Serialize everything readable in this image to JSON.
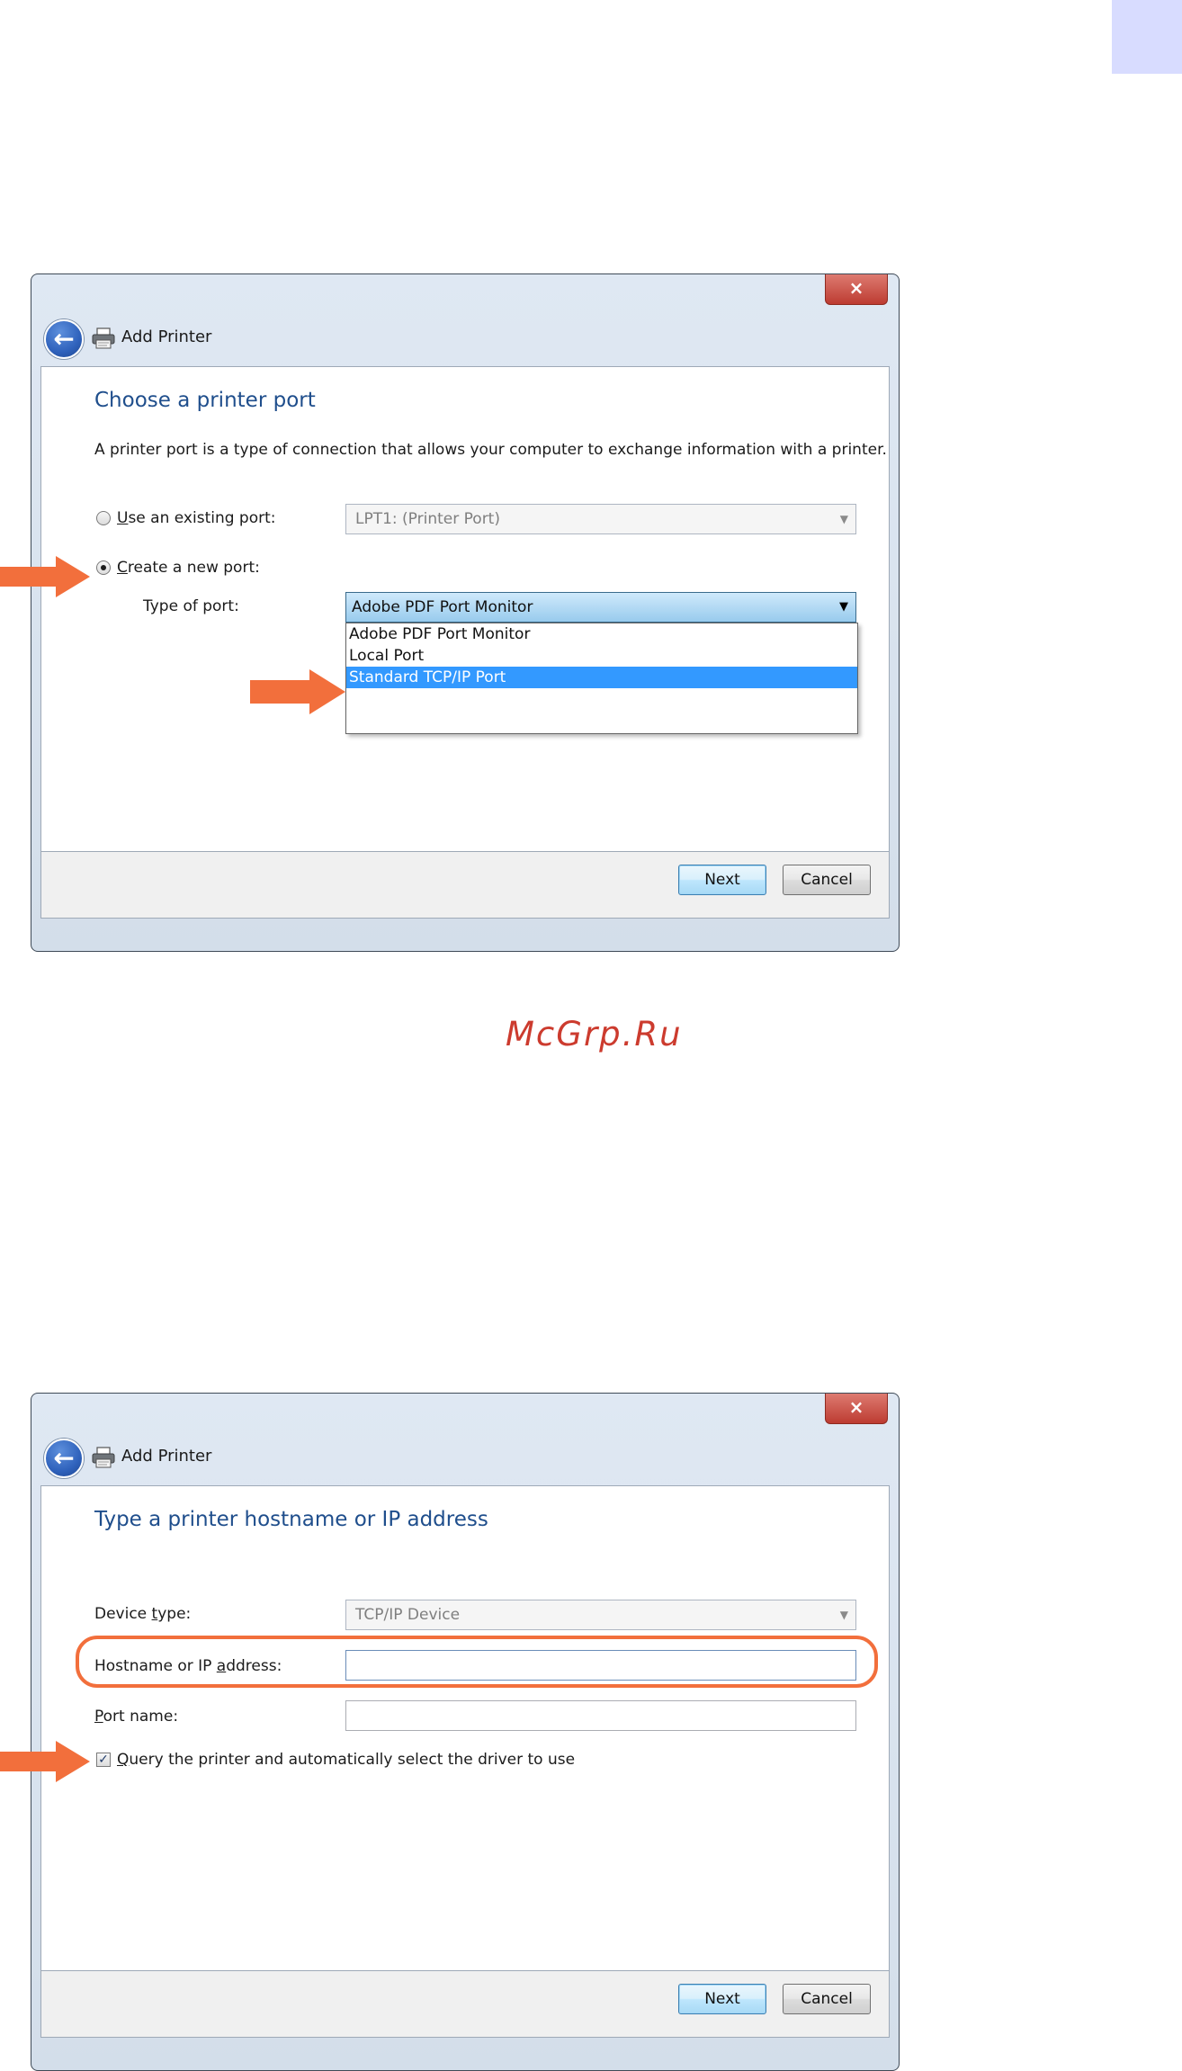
{
  "watermark": "McGrp.Ru",
  "top_window": {
    "title": "Add Printer",
    "close_glyph": "×",
    "heading": "Choose a printer port",
    "description": "A printer port is a type of connection that allows your computer to exchange information with a printer.",
    "existing_port": {
      "label_underline": "U",
      "label_rest": "se an existing port:",
      "value": "LPT1: (Printer Port)",
      "checked": false
    },
    "new_port": {
      "label_underline": "C",
      "label_rest": "reate a new port:",
      "checked": true
    },
    "type_of_port": {
      "label": "Type of port:",
      "value": "Adobe PDF Port Monitor"
    },
    "dropdown_options": [
      "Adobe PDF Port Monitor",
      "Local Port",
      "Standard TCP/IP Port"
    ],
    "selected_option": "Standard TCP/IP Port",
    "next_label": "Next",
    "cancel_label": "Cancel"
  },
  "bottom_window": {
    "title": "Add Printer",
    "close_glyph": "×",
    "heading": "Type a printer hostname or IP address",
    "device_type": {
      "label_prefix": "Device ",
      "label_underline": "t",
      "label_suffix": "ype:",
      "value": "TCP/IP Device"
    },
    "hostname": {
      "label_prefix": "Hostname or IP ",
      "label_underline": "a",
      "label_suffix": "ddress:",
      "value": ""
    },
    "port_name": {
      "label_underline": "P",
      "label_rest": "ort name:",
      "value": ""
    },
    "query": {
      "label_underline": "Q",
      "label_rest": "uery the printer and automatically select the driver to use",
      "checked": true,
      "check_glyph": "✓"
    },
    "next_label": "Next",
    "cancel_label": "Cancel"
  },
  "colors": {
    "accent_arrow": "#f26f3c",
    "heading_blue": "#1f4e8c",
    "selection_blue": "#3399ff",
    "corner_tab": "#d8dcff",
    "watermark_red": "#cc3b2e"
  }
}
